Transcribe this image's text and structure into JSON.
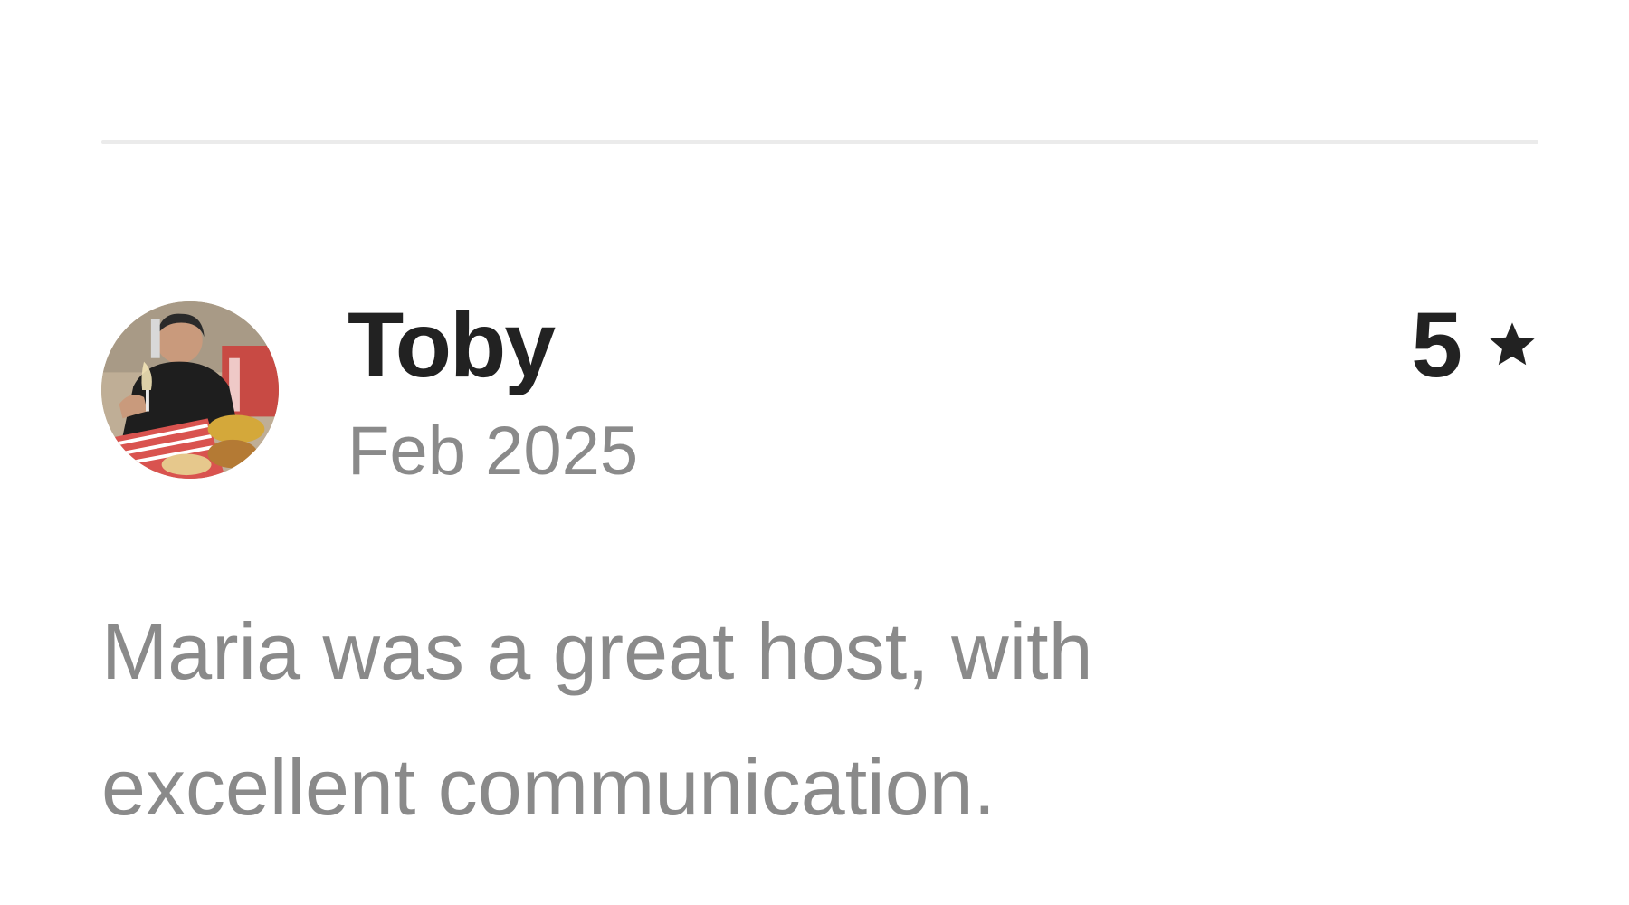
{
  "review": {
    "reviewer_name": "Toby",
    "date": "Feb 2025",
    "rating": "5",
    "rating_icon": "star-icon",
    "text": "Maria was a great host, with excellent communication."
  },
  "avatar": {
    "icon": "avatar-photo",
    "colors": {
      "background": "#c9b9a3",
      "shirt": "#1e1e1e",
      "skin": "#c99a7c",
      "tablecloth": "#d9534f"
    }
  },
  "colors": {
    "primary_text": "#222222",
    "secondary_text": "#8a8a8a",
    "divider": "#ebebeb"
  }
}
